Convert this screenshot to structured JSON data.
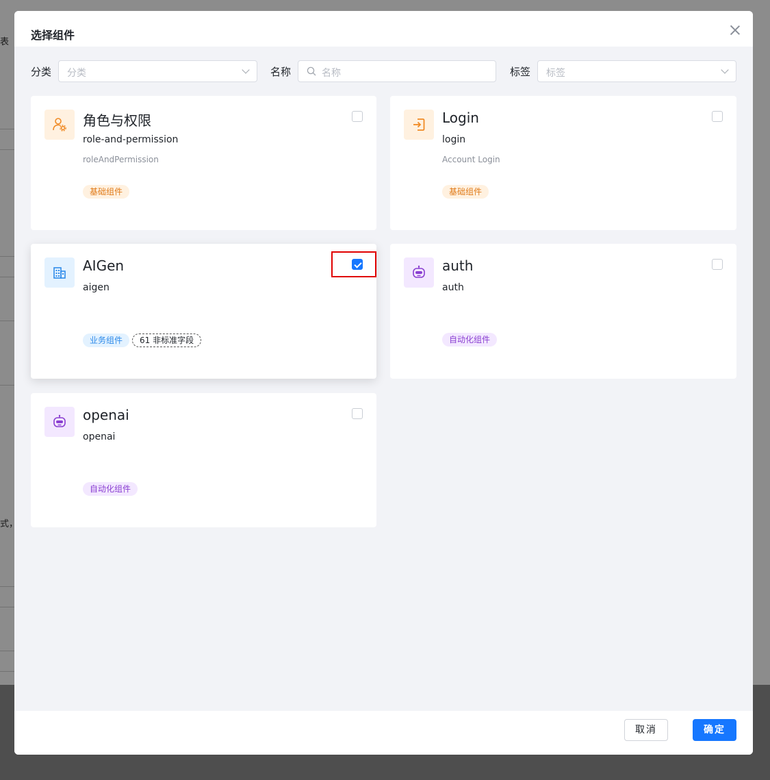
{
  "background": {
    "peek_text_top": "表",
    "peek_text_mid": "式，"
  },
  "modal": {
    "title": "选择组件",
    "filters": {
      "category_label": "分类",
      "category_placeholder": "分类",
      "name_label": "名称",
      "name_placeholder": "名称",
      "tag_label": "标签",
      "tag_placeholder": "标签"
    },
    "cards": [
      {
        "title": "角色与权限",
        "key": "role-and-permission",
        "desc": "roleAndPermission",
        "tags": [
          "基础组件"
        ],
        "checked": false,
        "icon": "user-gear-icon"
      },
      {
        "title": "Login",
        "key": "login",
        "desc": "Account Login",
        "tags": [
          "基础组件"
        ],
        "checked": false,
        "icon": "login-icon"
      },
      {
        "title": "AIGen",
        "key": "aigen",
        "desc": "",
        "tags": [
          "业务组件",
          "61 非标准字段"
        ],
        "checked": true,
        "icon": "building-icon"
      },
      {
        "title": "auth",
        "key": "auth",
        "desc": "",
        "tags": [
          "自动化组件"
        ],
        "checked": false,
        "icon": "robot-icon"
      },
      {
        "title": "openai",
        "key": "openai",
        "desc": "",
        "tags": [
          "自动化组件"
        ],
        "checked": false,
        "icon": "robot-icon"
      }
    ],
    "footer": {
      "cancel_label": "取消",
      "ok_label": "确定"
    }
  },
  "colors": {
    "primary": "#1677ff",
    "orange_tag": "#e07b1a",
    "blue_tag": "#2f8bea",
    "purple_tag": "#8a3fd1",
    "highlight": "#e00000"
  }
}
